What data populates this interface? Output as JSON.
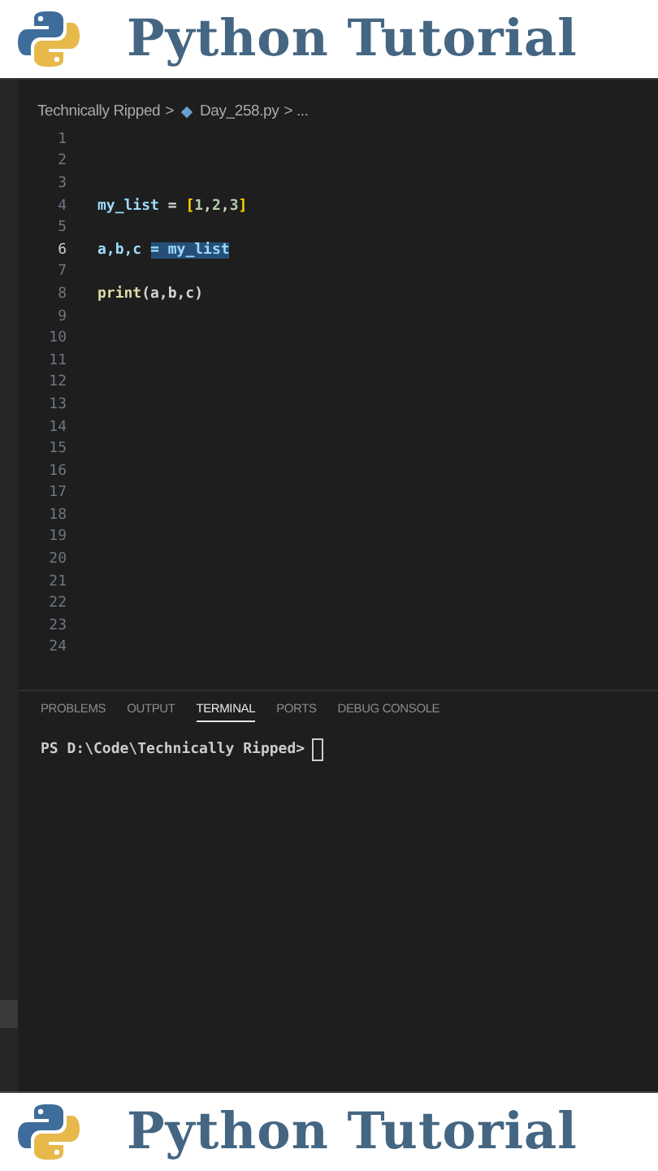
{
  "header_top": {
    "title": "Python Tutorial"
  },
  "breadcrumb": {
    "folder": "Technically Ripped",
    "separator": ">",
    "file": "Day_258.py",
    "trail": "> ..."
  },
  "lines": [
    {
      "number": "1",
      "active": false
    },
    {
      "number": "2",
      "active": false
    },
    {
      "number": "3",
      "active": false
    },
    {
      "number": "4",
      "active": false,
      "tokens": [
        {
          "text": "my_list",
          "kind": "variable",
          "selected": false
        },
        {
          "text": " = ",
          "kind": "operator",
          "selected": false
        },
        {
          "text": "[",
          "kind": "bracket",
          "selected": false
        },
        {
          "text": "1",
          "kind": "number",
          "selected": false
        },
        {
          "text": ",",
          "kind": "punct",
          "selected": false
        },
        {
          "text": "2",
          "kind": "number",
          "selected": false
        },
        {
          "text": ",",
          "kind": "punct",
          "selected": false
        },
        {
          "text": "3",
          "kind": "number",
          "selected": false
        },
        {
          "text": "]",
          "kind": "bracket",
          "selected": false
        }
      ]
    },
    {
      "number": "5",
      "active": false
    },
    {
      "number": "6",
      "active": true,
      "tokens": [
        {
          "text": "a,b,c ",
          "kind": "variable",
          "selected": false
        },
        {
          "text": "= my_list",
          "kind": "variable",
          "selected": true
        }
      ]
    },
    {
      "number": "7",
      "active": false
    },
    {
      "number": "8",
      "active": false,
      "tokens": [
        {
          "text": "print",
          "kind": "function",
          "selected": false
        },
        {
          "text": "(a,b,c)",
          "kind": "punct",
          "selected": false
        }
      ]
    },
    {
      "number": "9",
      "active": false
    },
    {
      "number": "10",
      "active": false
    },
    {
      "number": "11",
      "active": false
    },
    {
      "number": "12",
      "active": false
    },
    {
      "number": "13",
      "active": false
    },
    {
      "number": "14",
      "active": false
    },
    {
      "number": "15",
      "active": false
    },
    {
      "number": "16",
      "active": false
    },
    {
      "number": "17",
      "active": false
    },
    {
      "number": "18",
      "active": false
    },
    {
      "number": "19",
      "active": false
    },
    {
      "number": "20",
      "active": false
    },
    {
      "number": "21",
      "active": false
    },
    {
      "number": "22",
      "active": false
    },
    {
      "number": "23",
      "active": false
    },
    {
      "number": "24",
      "active": false
    }
  ],
  "panel_tabs": [
    {
      "label": "PROBLEMS",
      "selected": false
    },
    {
      "label": "OUTPUT",
      "selected": false
    },
    {
      "label": "TERMINAL",
      "selected": true
    },
    {
      "label": "PORTS",
      "selected": false
    },
    {
      "label": "DEBUG CONSOLE",
      "selected": false
    }
  ],
  "terminal": {
    "prompt": "PS D:\\Code\\Technically Ripped>"
  },
  "header_bottom": {
    "title": "Python Tutorial"
  }
}
